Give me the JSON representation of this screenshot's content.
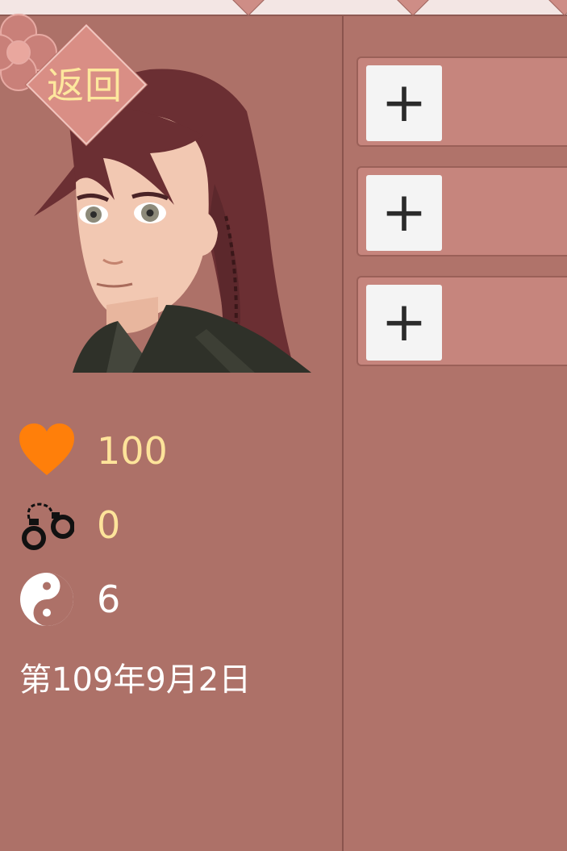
{
  "header": {
    "back_label": "返回"
  },
  "stats": {
    "health": {
      "icon": "heart-icon",
      "value": "100",
      "color": "#ff7f0a"
    },
    "shackles": {
      "icon": "handcuffs-icon",
      "value": "0"
    },
    "dao": {
      "icon": "yin-yang-icon",
      "value": "6"
    }
  },
  "date": "第109年9月2日",
  "slots": [
    {
      "add_label": "+"
    },
    {
      "add_label": "+"
    },
    {
      "add_label": "+"
    }
  ],
  "colors": {
    "panel": "#ad7168",
    "slot": "#c6857d",
    "accent_text": "#fde39a"
  }
}
